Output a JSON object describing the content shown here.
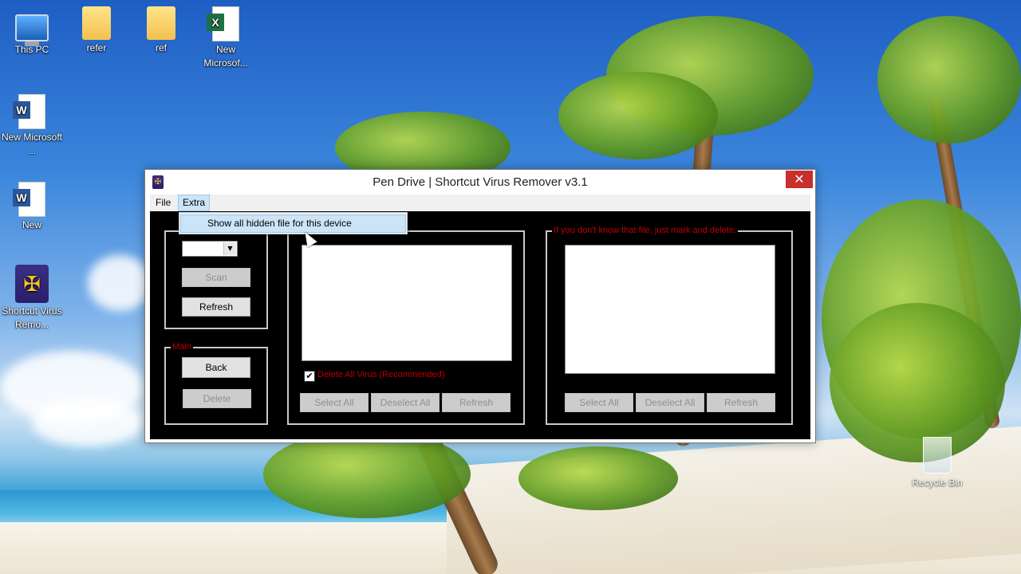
{
  "desktop": {
    "icons": [
      {
        "label": "This PC",
        "icon": "computer-icon"
      },
      {
        "label": "refer",
        "icon": "folder-icon"
      },
      {
        "label": "ref",
        "icon": "folder-icon"
      },
      {
        "label": "New Microsof...",
        "icon": "excel-document-icon"
      },
      {
        "label": "New Microsoft ...",
        "icon": "word-document-icon"
      },
      {
        "label": "New",
        "icon": "word-document-icon"
      },
      {
        "label": "Shortcut Virus Remo...",
        "icon": "shortcut-virus-remover-icon"
      }
    ],
    "recycle_bin": {
      "label": "Recycle Bin",
      "icon": "recycle-bin-icon"
    }
  },
  "window": {
    "title": "Pen Drive | Shortcut Virus Remover v3.1",
    "close_symbol": "✕",
    "menu": {
      "file": "File",
      "extra": "Extra"
    },
    "dropdown": {
      "items": [
        "Show all hidden file for this device"
      ]
    },
    "left_panel": {
      "drive_select_value": "",
      "scan_button": "Scan",
      "refresh_button": "Refresh"
    },
    "main_panel": {
      "label": "Main",
      "back_button": "Back",
      "delete_button": "Delete"
    },
    "middle_panel": {
      "checkbox_label": "Delete All Virus (Recommended)",
      "checkbox_checked": true,
      "select_all": "Select All",
      "deselect_all": "Deselect All",
      "refresh": "Refresh"
    },
    "right_panel": {
      "label": "If you don't know that file, just mark and delete:",
      "select_all": "Select All",
      "deselect_all": "Deselect All",
      "refresh": "Refresh"
    }
  },
  "colors": {
    "label_red": "#c00000",
    "close_red": "#c7302b",
    "menu_highlight": "#cce4f7"
  }
}
